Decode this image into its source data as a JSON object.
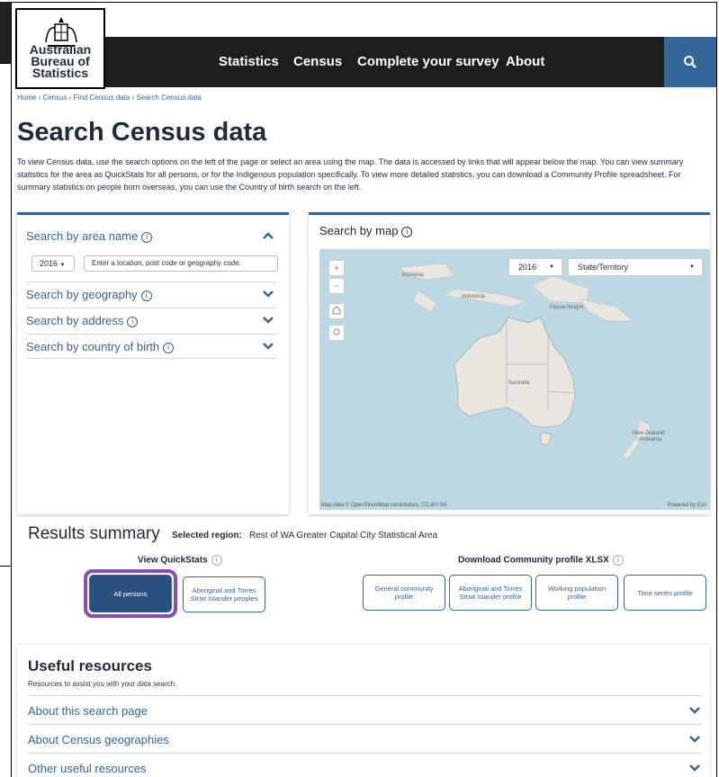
{
  "header": {
    "logo_lines": [
      "Australian",
      "Bureau of",
      "Statistics"
    ],
    "nav": [
      "Statistics",
      "Census",
      "Complete your survey",
      "About"
    ],
    "search_icon": "search-icon"
  },
  "breadcrumb": "Home › Census › Find Census data › Search Census data",
  "page_title": "Search Census data",
  "intro": "To view Census data, use the search options on the left of the page or select an area using the map. The data is accessed by links that will appear below the map. You can view summary statistics for the area as QuickStats for all persons, or for the Indigenous population specifically. To view more detailed statistics, you can download a Community Profile spreadsheet. For summary statistics on people born overseas, you can use the Country of birth search on the left.",
  "search_panel": {
    "area_name_label": "Search by area name",
    "year_value": "2016",
    "location_placeholder": "Enter a location, post code or geography code.",
    "geography_label": "Search by geography",
    "address_label": "Search by address",
    "country_label": "Search by country of birth"
  },
  "map_panel": {
    "title": "Search by map",
    "year_value": "2016",
    "geo_value": "State/Territory",
    "labels": {
      "malaysia": "Malaysia",
      "indonesia": "Indonesia",
      "png": "Papua Niugini",
      "australia": "Australia",
      "nz1": "New Zealand",
      "nz2": "Aotearoa"
    },
    "attribution": "Map data © OpenStreetMap contributors, CC-BY-SA",
    "powered": "Powered by Esri"
  },
  "results": {
    "title": "Results summary",
    "region_label": "Selected region:",
    "region_value": "Rest of WA Greater Capital City Statistical Area",
    "quickstats_label": "View QuickStats",
    "quickstats_buttons": [
      "All persons",
      "Aboriginal and Torres Strait Islander peoples"
    ],
    "download_label": "Download Community profile XLSX",
    "download_buttons": [
      "General community profile",
      "Aboriginal and Torres Strait Islander profile",
      "Working population profile",
      "Time series profile"
    ]
  },
  "useful": {
    "title": "Useful resources",
    "description": "Resources to assist you with your data search.",
    "items": [
      "About this search page",
      "About Census geographies",
      "Other useful resources"
    ]
  },
  "colors": {
    "brand_blue": "#336699",
    "nav_bg": "#1e1e1e",
    "focus": "#8a4bb6"
  }
}
